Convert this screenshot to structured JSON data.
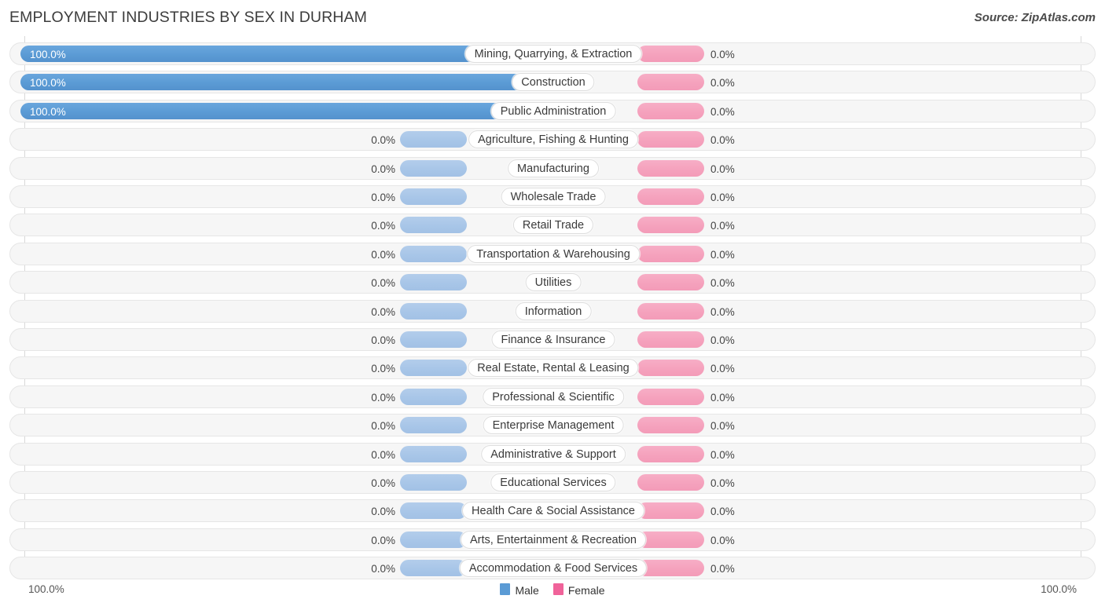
{
  "header": {
    "title": "EMPLOYMENT INDUSTRIES BY SEX IN DURHAM",
    "source": "Source: ZipAtlas.com"
  },
  "axis": {
    "left_label": "100.0%",
    "right_label": "100.0%"
  },
  "legend": {
    "items": [
      {
        "label": "Male",
        "color": "#5b9bd5"
      },
      {
        "label": "Female",
        "color": "#f0639a"
      }
    ]
  },
  "colors": {
    "male_full": "#5b9bd5",
    "male_stub": "#a8c6e8",
    "female_stub": "#f5a2bd",
    "track": "#f6f6f6",
    "track_border": "#e6e6e6",
    "axis_line": "#d8d8d8"
  },
  "chart_data": {
    "type": "bar",
    "title": "EMPLOYMENT INDUSTRIES BY SEX IN DURHAM",
    "subtitle": "",
    "xlabel": "",
    "ylabel": "",
    "orientation": "horizontal-diverging",
    "xlim": [
      0,
      100
    ],
    "grid": false,
    "legend_position": "bottom-center",
    "categories": [
      "Mining, Quarrying, & Extraction",
      "Construction",
      "Public Administration",
      "Agriculture, Fishing & Hunting",
      "Manufacturing",
      "Wholesale Trade",
      "Retail Trade",
      "Transportation & Warehousing",
      "Utilities",
      "Information",
      "Finance & Insurance",
      "Real Estate, Rental & Leasing",
      "Professional & Scientific",
      "Enterprise Management",
      "Administrative & Support",
      "Educational Services",
      "Health Care & Social Assistance",
      "Arts, Entertainment & Recreation",
      "Accommodation & Food Services"
    ],
    "series": [
      {
        "name": "Male",
        "values": [
          100.0,
          100.0,
          100.0,
          0.0,
          0.0,
          0.0,
          0.0,
          0.0,
          0.0,
          0.0,
          0.0,
          0.0,
          0.0,
          0.0,
          0.0,
          0.0,
          0.0,
          0.0,
          0.0
        ],
        "labels": [
          "100.0%",
          "100.0%",
          "100.0%",
          "0.0%",
          "0.0%",
          "0.0%",
          "0.0%",
          "0.0%",
          "0.0%",
          "0.0%",
          "0.0%",
          "0.0%",
          "0.0%",
          "0.0%",
          "0.0%",
          "0.0%",
          "0.0%",
          "0.0%",
          "0.0%"
        ]
      },
      {
        "name": "Female",
        "values": [
          0.0,
          0.0,
          0.0,
          0.0,
          0.0,
          0.0,
          0.0,
          0.0,
          0.0,
          0.0,
          0.0,
          0.0,
          0.0,
          0.0,
          0.0,
          0.0,
          0.0,
          0.0,
          0.0
        ],
        "labels": [
          "0.0%",
          "0.0%",
          "0.0%",
          "0.0%",
          "0.0%",
          "0.0%",
          "0.0%",
          "0.0%",
          "0.0%",
          "0.0%",
          "0.0%",
          "0.0%",
          "0.0%",
          "0.0%",
          "0.0%",
          "0.0%",
          "0.0%",
          "0.0%",
          "0.0%"
        ]
      }
    ]
  }
}
